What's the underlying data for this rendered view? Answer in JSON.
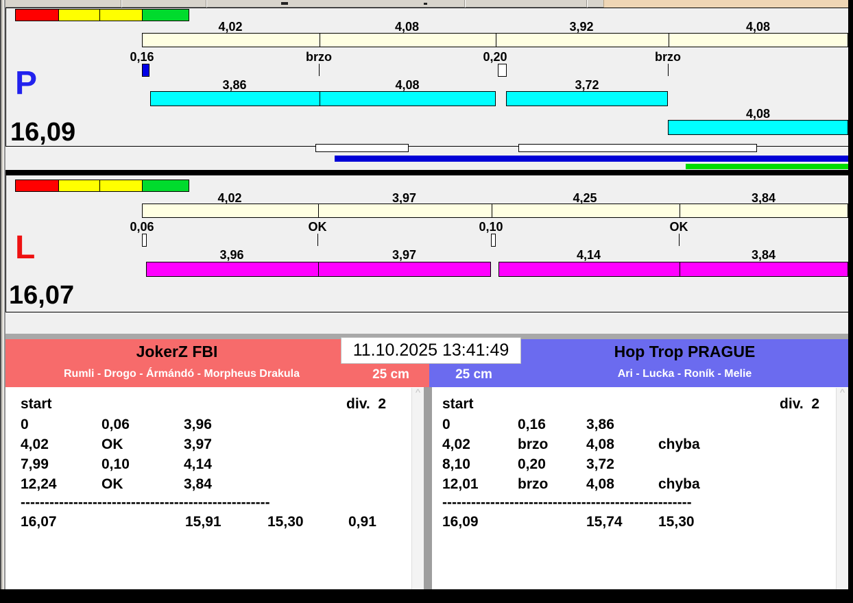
{
  "datetime": "11.10.2025 13:41:49",
  "icons": {
    "scroll_up": "^"
  },
  "colors": {
    "cyan_bar": "#00FFFF",
    "magenta_bar": "#FF00FF",
    "cream_bar": "#FFFFE2",
    "blue_bar": "#0000D6",
    "green_bar": "#00DB00",
    "swatch_red": "#FF0000",
    "swatch_yellow": "#FFFF00",
    "swatch_green": "#00DB2D",
    "team_left_header": "#F76B6B",
    "team_right_header": "#6B6BEF",
    "lane_p_letter": "#2222EE",
    "lane_l_letter": "#EE1111"
  },
  "lanes": {
    "p": {
      "letter": "P",
      "total": "16,09",
      "splits": [
        "4,02",
        "4,08",
        "3,92",
        "4,08"
      ],
      "markers": [
        {
          "label": "0,16",
          "type": "box-blue"
        },
        {
          "label": "brzo",
          "type": "tick"
        },
        {
          "label": "0,20",
          "type": "box-white"
        },
        {
          "label": "brzo",
          "type": "tick"
        }
      ],
      "runs": [
        "3,86",
        "4,08",
        "3,72",
        "4,08"
      ]
    },
    "l": {
      "letter": "L",
      "total": "16,07",
      "splits": [
        "4,02",
        "3,97",
        "4,25",
        "3,84"
      ],
      "markers": [
        {
          "label": "0,06",
          "type": "box-white-narrow"
        },
        {
          "label": "OK",
          "type": "tick"
        },
        {
          "label": "0,10",
          "type": "box-white-narrow"
        },
        {
          "label": "OK",
          "type": "tick"
        }
      ],
      "runs": [
        "3,96",
        "3,97",
        "4,14",
        "3,84"
      ]
    }
  },
  "panels": {
    "left": {
      "team": "JokerZ FBI",
      "dogs": "Rumli - Drogo - Ármándó - Morpheus Drakula",
      "height": "25 cm",
      "start_label": "start",
      "division": "div.  2",
      "rows": [
        {
          "t": "0",
          "s": "0,06",
          "r": "3,96",
          "e": ""
        },
        {
          "t": "4,02",
          "s": "OK",
          "r": "3,97",
          "e": ""
        },
        {
          "t": "7,99",
          "s": "0,10",
          "r": "4,14",
          "e": ""
        },
        {
          "t": "12,24",
          "s": "OK",
          "r": "3,84",
          "e": ""
        }
      ],
      "separator": "----------------------------------------------------",
      "totals": {
        "total": "16,07",
        "sum": "15,91",
        "best": "15,30",
        "diff": "0,91"
      }
    },
    "right": {
      "team": "Hop Trop PRAGUE",
      "dogs": "Ari - Lucka - Roník - Melie",
      "height": "25 cm",
      "start_label": "start",
      "division": "div.  2",
      "rows": [
        {
          "t": "0",
          "s": "0,16",
          "r": "3,86",
          "e": ""
        },
        {
          "t": "4,02",
          "s": "brzo",
          "r": "4,08",
          "e": "chyba"
        },
        {
          "t": "8,10",
          "s": "0,20",
          "r": "3,72",
          "e": ""
        },
        {
          "t": "12,01",
          "s": "brzo",
          "r": "4,08",
          "e": "chyba"
        }
      ],
      "separator": "----------------------------------------------------",
      "totals": {
        "total": "16,09",
        "sum": "15,74",
        "best": "15,30",
        "diff": ""
      }
    }
  }
}
